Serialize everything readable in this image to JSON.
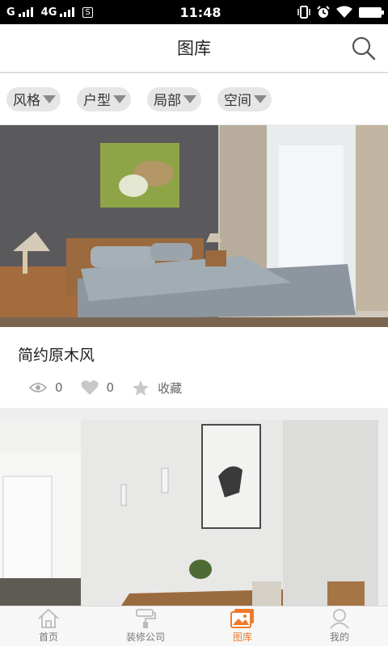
{
  "status_bar": {
    "network_left": "G",
    "network_mid": "4G",
    "sim_label": "S",
    "time": "11:48",
    "icons": [
      "vibrate-icon",
      "alarm-icon",
      "wifi-icon",
      "battery-icon"
    ]
  },
  "header": {
    "title": "图库",
    "search_icon": "search-icon"
  },
  "filters": [
    {
      "label": "风格"
    },
    {
      "label": "户型"
    },
    {
      "label": "局部"
    },
    {
      "label": "空间"
    }
  ],
  "cards": [
    {
      "title": "简约原木风",
      "views": "0",
      "likes": "0",
      "favorite_label": "收藏"
    }
  ],
  "tabs": [
    {
      "label": "首页",
      "icon": "home-icon",
      "active": false
    },
    {
      "label": "装修公司",
      "icon": "paint-roller-icon",
      "active": false
    },
    {
      "label": "图库",
      "icon": "gallery-icon",
      "active": true
    },
    {
      "label": "我的",
      "icon": "person-icon",
      "active": false
    }
  ],
  "colors": {
    "accent": "#f07a2a",
    "filter_bg": "#e6e6e6",
    "inactive": "#999999"
  }
}
